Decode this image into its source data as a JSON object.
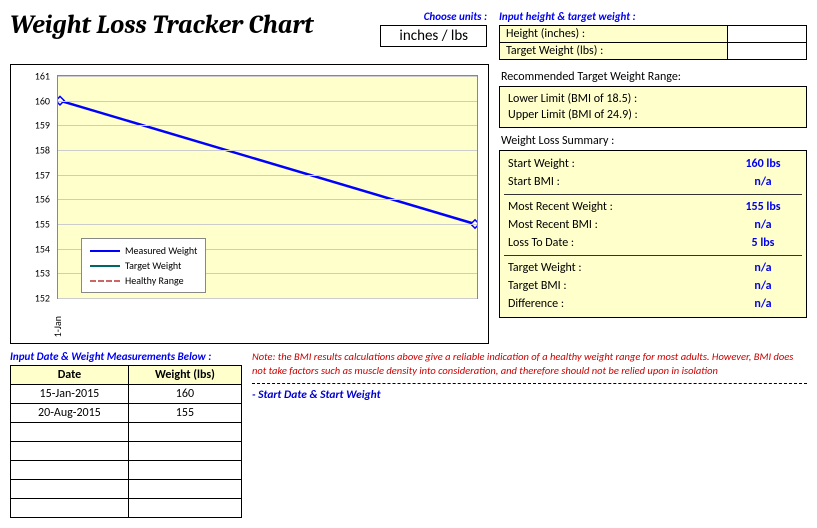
{
  "title": "Weight Loss Tracker Chart",
  "units": {
    "prompt": "Choose units :",
    "value": "inches / lbs"
  },
  "height_target": {
    "prompt": "Input height & target weight :",
    "height_label": "Height (inches) :",
    "height_value": "",
    "target_label": "Target Weight (lbs) :",
    "target_value": ""
  },
  "range": {
    "heading": "Recommended Target Weight Range:",
    "lower_label": "Lower Limit (BMI of 18.5) :",
    "lower_value": "",
    "upper_label": "Upper Limit (BMI of 24.9) :",
    "upper_value": ""
  },
  "summary": {
    "heading": "Weight Loss Summary :",
    "rows": [
      {
        "label": "Start Weight :",
        "value": "160 lbs"
      },
      {
        "label": "Start BMI :",
        "value": "n/a"
      },
      {
        "label": "Most Recent Weight :",
        "value": "155 lbs"
      },
      {
        "label": "Most Recent BMI :",
        "value": "n/a"
      },
      {
        "label": "Loss To Date :",
        "value": "5 lbs"
      },
      {
        "label": "Target Weight :",
        "value": "n/a"
      },
      {
        "label": "Target BMI :",
        "value": "n/a"
      },
      {
        "label": "Difference :",
        "value": "n/a"
      }
    ]
  },
  "legend": {
    "measured": "Measured Weight",
    "target": "Target Weight",
    "healthy": "Healthy Range"
  },
  "x_tick": "1-Jan",
  "input_section": {
    "prompt": "Input Date & Weight Measurements Below :",
    "col_date": "Date",
    "col_weight": "Weight (lbs)",
    "rows": [
      {
        "date": "15-Jan-2015",
        "weight": "160"
      },
      {
        "date": "20-Aug-2015",
        "weight": "155"
      },
      {
        "date": "",
        "weight": ""
      },
      {
        "date": "",
        "weight": ""
      },
      {
        "date": "",
        "weight": ""
      },
      {
        "date": "",
        "weight": ""
      },
      {
        "date": "",
        "weight": ""
      }
    ]
  },
  "bmi_note": "Note: the BMI results calculations above give a reliable indication of a healthy weight range for most adults. However, BMI does not take factors such as muscle density into consideration, and therefore should not be relied upon in isolation",
  "start_note": "- Start Date & Start Weight",
  "chart_data": {
    "type": "line",
    "title": "",
    "xlabel": "",
    "ylabel": "",
    "ylim": [
      152,
      161
    ],
    "y_ticks": [
      152,
      153,
      154,
      155,
      156,
      157,
      158,
      159,
      160,
      161
    ],
    "x_categories": [
      "1-Jan"
    ],
    "series": [
      {
        "name": "Measured Weight",
        "color": "#0000ff",
        "style": "solid",
        "values": [
          160,
          155
        ]
      },
      {
        "name": "Target Weight",
        "color": "#006666",
        "style": "solid",
        "values": []
      },
      {
        "name": "Healthy Range",
        "color": "#cc6666",
        "style": "dashed",
        "values": []
      }
    ]
  }
}
